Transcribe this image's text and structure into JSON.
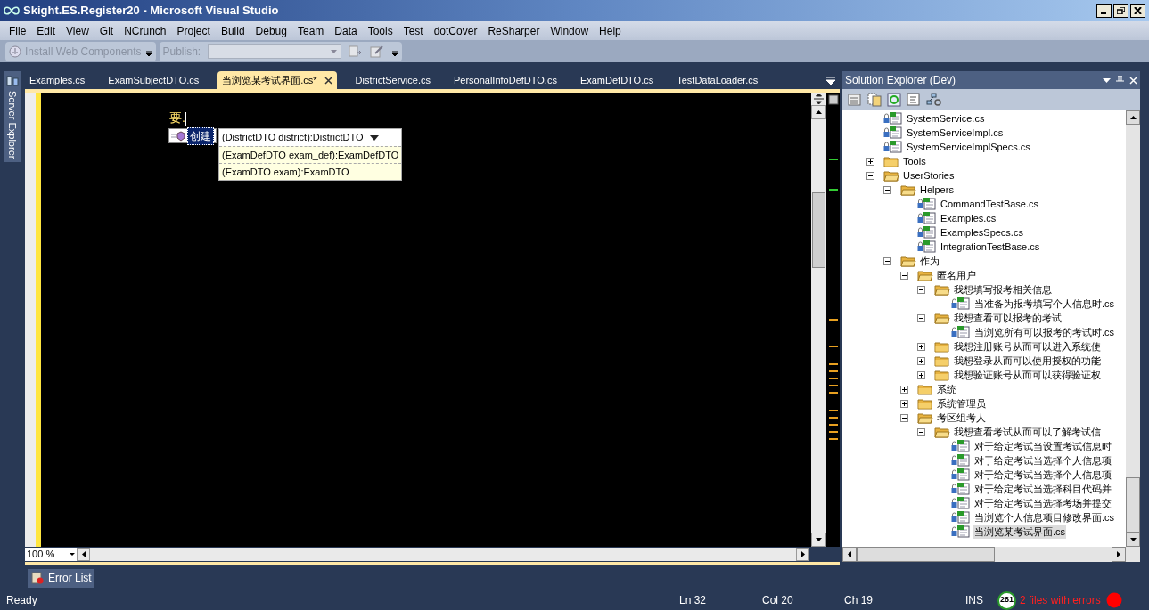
{
  "window": {
    "title": "Skight.ES.Register20 - Microsoft Visual Studio"
  },
  "menu": [
    "File",
    "Edit",
    "View",
    "Git",
    "NCrunch",
    "Project",
    "Build",
    "Debug",
    "Team",
    "Data",
    "Tools",
    "Test",
    "dotCover",
    "ReSharper",
    "Window",
    "Help"
  ],
  "toolbar": {
    "install_button": "Install Web Components",
    "publish_label": "Publish:",
    "install_disabled": true
  },
  "side_tab": "Server Explorer",
  "tabs": [
    {
      "label": "Examples.cs",
      "selected": false
    },
    {
      "label": "ExamSubjectDTO.cs",
      "selected": false
    },
    {
      "label": "当浏览某考试界面.cs*",
      "selected": true
    },
    {
      "label": "DistrictService.cs",
      "selected": false
    },
    {
      "label": "PersonalInfoDefDTO.cs",
      "selected": false
    },
    {
      "label": "ExamDefDTO.cs",
      "selected": false
    },
    {
      "label": "TestDataLoader.cs",
      "selected": false
    }
  ],
  "editor": {
    "code": "要.",
    "completion": "创建",
    "overloads": [
      {
        "text": "(DistrictDTO district):DistrictDTO",
        "selected": true
      },
      {
        "text": "(ExamDefDTO exam_def):ExamDefDTO",
        "selected": false
      },
      {
        "text": "(ExamDTO exam):ExamDTO",
        "selected": false
      }
    ],
    "zoom": "100 %"
  },
  "solution_explorer": {
    "title": "Solution Explorer (Dev)",
    "tree": [
      {
        "kind": "file",
        "label": "SystemService.cs",
        "selected": false
      },
      {
        "kind": "file",
        "label": "SystemServiceImpl.cs",
        "selected": false
      },
      {
        "kind": "file",
        "label": "SystemServiceImplSpecs.cs",
        "selected": false
      },
      {
        "kind": "folder",
        "label": "Tools",
        "expanded": false
      },
      {
        "kind": "folder",
        "label": "UserStories",
        "expanded": true,
        "children": [
          {
            "kind": "folder",
            "label": "Helpers",
            "expanded": true,
            "children": [
              {
                "kind": "file",
                "label": "CommandTestBase.cs",
                "selected": false
              },
              {
                "kind": "file",
                "label": "Examples.cs",
                "selected": false
              },
              {
                "kind": "file",
                "label": "ExamplesSpecs.cs",
                "selected": false
              },
              {
                "kind": "file",
                "label": "IntegrationTestBase.cs",
                "selected": false
              }
            ]
          },
          {
            "kind": "folder",
            "label": "作为",
            "expanded": true,
            "children": [
              {
                "kind": "folder",
                "label": "匿名用户",
                "expanded": true,
                "children": [
                  {
                    "kind": "folder",
                    "label": "我想填写报考相关信息",
                    "expanded": true,
                    "children": [
                      {
                        "kind": "file",
                        "label": "当准备为报考填写个人信息时.cs",
                        "selected": false
                      }
                    ]
                  },
                  {
                    "kind": "folder",
                    "label": "我想查看可以报考的考试",
                    "expanded": true,
                    "children": [
                      {
                        "kind": "file",
                        "label": "当浏览所有可以报考的考试时.cs",
                        "selected": false
                      }
                    ]
                  },
                  {
                    "kind": "folder",
                    "label": "我想注册账号从而可以进入系统使",
                    "expanded": false
                  },
                  {
                    "kind": "folder",
                    "label": "我想登录从而可以使用授权的功能",
                    "expanded": false
                  },
                  {
                    "kind": "folder",
                    "label": "我想验证账号从而可以获得验证权",
                    "expanded": false
                  }
                ]
              },
              {
                "kind": "folder",
                "label": "系统",
                "expanded": false
              },
              {
                "kind": "folder",
                "label": "系统管理员",
                "expanded": false
              },
              {
                "kind": "folder",
                "label": "考区组考人",
                "expanded": true,
                "children": [
                  {
                    "kind": "folder",
                    "label": "我想查看考试从而可以了解考试信",
                    "expanded": true,
                    "children": [
                      {
                        "kind": "file",
                        "label": "对于给定考试当设置考试信息时",
                        "selected": false
                      },
                      {
                        "kind": "file",
                        "label": "对于给定考试当选择个人信息项",
                        "selected": false
                      },
                      {
                        "kind": "file",
                        "label": "对于给定考试当选择个人信息项",
                        "selected": false
                      },
                      {
                        "kind": "file",
                        "label": "对于给定考试当选择科目代码并",
                        "selected": false
                      },
                      {
                        "kind": "file",
                        "label": "对于给定考试当选择考场并提交",
                        "selected": false
                      },
                      {
                        "kind": "file",
                        "label": "当浏览个人信息项目修改界面.cs",
                        "selected": false
                      },
                      {
                        "kind": "file",
                        "label": "当浏览某考试界面.cs",
                        "selected": true
                      }
                    ]
                  }
                ]
              }
            ]
          }
        ]
      }
    ]
  },
  "bottom_tab": "Error List",
  "status_bar": {
    "state": "Ready",
    "line": "Ln 32",
    "col": "Col 20",
    "ch": "Ch 19",
    "mode": "INS",
    "count": "281",
    "errors": "2 files with errors"
  }
}
